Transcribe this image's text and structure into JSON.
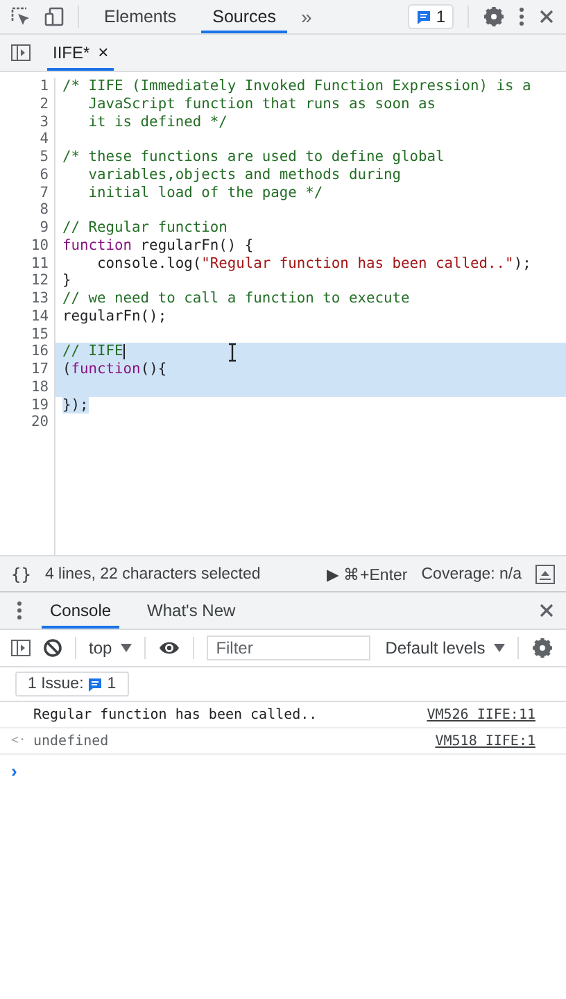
{
  "top_tabs": [
    {
      "label": "Elements",
      "selected": false
    },
    {
      "label": "Sources",
      "selected": true
    }
  ],
  "more_tabs": "»",
  "issues_badge": "1",
  "file_tabs": [
    {
      "label": "IIFE*",
      "selected": true,
      "close": "×"
    }
  ],
  "code_lines": [
    {
      "number": "1",
      "selected": false,
      "tokens": [
        {
          "kind": "comment",
          "text": "/* IIFE (Immediately Invoked Function Expression) is a"
        }
      ]
    },
    {
      "number": "2",
      "selected": false,
      "tokens": [
        {
          "kind": "comment",
          "text": "   JavaScript function that runs as soon as"
        }
      ]
    },
    {
      "number": "3",
      "selected": false,
      "tokens": [
        {
          "kind": "comment",
          "text": "   it is defined */"
        }
      ]
    },
    {
      "number": "4",
      "selected": false
    },
    {
      "number": "5",
      "selected": false,
      "tokens": [
        {
          "kind": "comment",
          "text": "/* these functions are used to define global"
        }
      ]
    },
    {
      "number": "6",
      "selected": false,
      "tokens": [
        {
          "kind": "comment",
          "text": "   variables,objects and methods during"
        }
      ]
    },
    {
      "number": "7",
      "selected": false,
      "tokens": [
        {
          "kind": "comment",
          "text": "   initial load of the page */"
        }
      ]
    },
    {
      "number": "8",
      "selected": false
    },
    {
      "number": "9",
      "selected": false,
      "tokens": [
        {
          "kind": "comment",
          "text": "// Regular function"
        }
      ]
    },
    {
      "number": "10",
      "selected": false,
      "tokens": [
        {
          "kind": "keyword",
          "text": "function"
        },
        {
          "kind": "plain",
          "text": " regularFn() {"
        }
      ]
    },
    {
      "number": "11",
      "selected": false,
      "tokens": [
        {
          "kind": "plain",
          "text": "    console.log("
        },
        {
          "kind": "string",
          "text": "\"Regular function has been called..\""
        },
        {
          "kind": "plain",
          "text": ");"
        }
      ]
    },
    {
      "number": "12",
      "selected": false,
      "tokens": [
        {
          "kind": "plain",
          "text": "}"
        }
      ]
    },
    {
      "number": "13",
      "selected": false,
      "tokens": [
        {
          "kind": "comment",
          "text": "// we need to call a function to execute"
        }
      ]
    },
    {
      "number": "14",
      "selected": false,
      "tokens": [
        {
          "kind": "plain",
          "text": "regularFn();"
        }
      ]
    },
    {
      "number": "15",
      "selected": false
    },
    {
      "number": "16",
      "selected": true,
      "to_end": true,
      "caret": true,
      "tokens": [
        {
          "kind": "comment",
          "text": "// IIFE"
        }
      ]
    },
    {
      "number": "17",
      "selected": true,
      "to_end": true,
      "tokens": [
        {
          "kind": "plain",
          "text": "("
        },
        {
          "kind": "keyword",
          "text": "function"
        },
        {
          "kind": "plain",
          "text": "(){"
        }
      ]
    },
    {
      "number": "18",
      "selected": true,
      "to_end": true
    },
    {
      "number": "19",
      "selected": true,
      "to_end": false,
      "tokens": [
        {
          "kind": "plain",
          "text": "});"
        }
      ]
    },
    {
      "number": "20",
      "selected": false
    }
  ],
  "status_bar": {
    "format": "{}",
    "selection": "4 lines, 22 characters selected",
    "run": "▶ ⌘+Enter",
    "coverage": "Coverage: n/a"
  },
  "drawer_tabs": [
    {
      "label": "Console",
      "selected": true
    },
    {
      "label": "What's New",
      "selected": false
    }
  ],
  "console_toolbar": {
    "context": "top",
    "filter_placeholder": "Filter",
    "levels": "Default levels"
  },
  "issues_button": {
    "label": "1 Issue:",
    "count": "1"
  },
  "messages": [
    {
      "kind": "log",
      "text": "Regular function has been called..",
      "source": "VM526 IIFE:11"
    },
    {
      "kind": "result",
      "prefix": "<·",
      "text": "undefined",
      "source": "VM518 IIFE:1"
    }
  ],
  "prompt": "›"
}
